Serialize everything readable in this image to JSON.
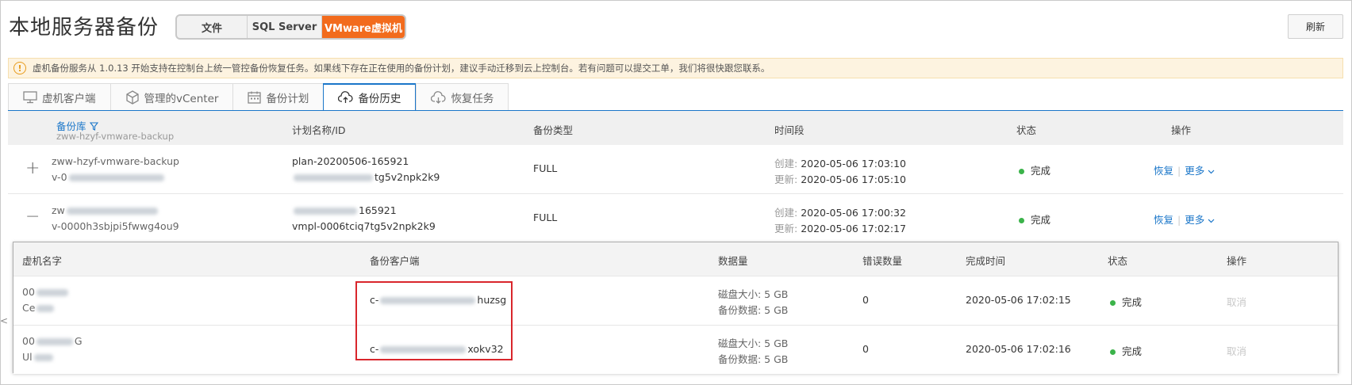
{
  "page_title": "本地服务器备份",
  "segments": [
    {
      "label": "文件",
      "active": false,
      "width": 97
    },
    {
      "label": "SQL Server",
      "active": false,
      "width": 100
    },
    {
      "label": "VMware虚拟机",
      "active": true,
      "width": 112
    }
  ],
  "refresh_label": "刷新",
  "notice": "虚机备份服务从 1.0.13 开始支持在控制台上统一管控备份恢复任务。如果线下存在正在使用的备份计划，建议手动迁移到云上控制台。若有问题可以提交工单，我们将很快跟您联系。",
  "tabs": [
    {
      "label": "虚机客户端",
      "icon": "monitor-icon"
    },
    {
      "label": "管理的vCenter",
      "icon": "cube-icon"
    },
    {
      "label": "备份计划",
      "icon": "calendar-icon"
    },
    {
      "label": "备份历史",
      "icon": "cloud-upload-icon",
      "active": true
    },
    {
      "label": "恢复任务",
      "icon": "cloud-download-icon"
    }
  ],
  "table": {
    "headers": {
      "vault": "备份库",
      "vault_filter_value": "zww-hzyf-vmware-backup",
      "plan": "计划名称/ID",
      "type": "备份类型",
      "period": "时间段",
      "status": "状态",
      "actions": "操作"
    },
    "rows": [
      {
        "expand": "+",
        "vault_line1": "zww-hzyf-vmware-backup",
        "vault_line2": "v-0",
        "plan_line1": "plan-20200506-165921",
        "plan_line2_suffix": "tg5v2npk2k9",
        "type": "FULL",
        "created_label": "创建:",
        "created": "2020-05-06 17:03:10",
        "updated_label": "更新:",
        "updated": "2020-05-06 17:05:10",
        "status": "完成",
        "action_restore": "恢复",
        "action_more": "更多"
      },
      {
        "expand": "−",
        "vault_line1": "zw",
        "vault_line2": "v-0000h3sbjpi5fwwg4ou9",
        "plan_line1_suffix": "165921",
        "plan_line2": "vmpl-0006tciq7tg5v2npk2k9",
        "type": "FULL",
        "created_label": "创建:",
        "created": "2020-05-06 17:00:32",
        "updated_label": "更新:",
        "updated": "2020-05-06 17:02:17",
        "status": "完成",
        "action_restore": "恢复",
        "action_more": "更多"
      }
    ]
  },
  "inner_table": {
    "headers": {
      "vm_name": "虚机名字",
      "client": "备份客户端",
      "data": "数据量",
      "errors": "错误数量",
      "completed": "完成时间",
      "status": "状态",
      "actions": "操作"
    },
    "rows": [
      {
        "vm_line1": "00",
        "vm_line2": "Ce",
        "client_prefix": "c-",
        "client_suffix": "huzsg",
        "disk_size": "磁盘大小: 5 GB",
        "backup_data": "备份数据: 5 GB",
        "errors": "0",
        "completed": "2020-05-06 17:02:15",
        "status": "完成",
        "action": "取消"
      },
      {
        "vm_line1": "00",
        "vm_line1_suffix": "G",
        "vm_line2": "Ul",
        "client_prefix": "c-",
        "client_suffix": "xokv32",
        "disk_size": "磁盘大小: 5 GB",
        "backup_data": "备份数据: 5 GB",
        "errors": "0",
        "completed": "2020-05-06 17:02:16",
        "status": "完成",
        "action": "取消"
      }
    ]
  },
  "left_edge_glyph": "<",
  "colors": {
    "accent_orange": "#f26b1d",
    "link_blue": "#1a76c9",
    "status_green": "#3bb34a",
    "highlight_red": "#d9262c"
  }
}
